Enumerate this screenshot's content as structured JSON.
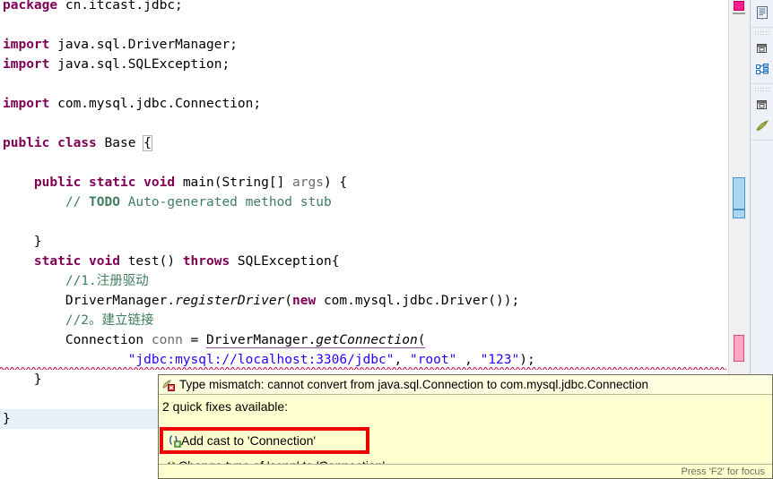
{
  "editor": {
    "language": "java",
    "lines": [
      {
        "id": 0,
        "indent": 0,
        "tokens": [
          {
            "t": "kw",
            "v": "package"
          },
          {
            "t": "p",
            "v": " cn.itcast.jdbc;"
          }
        ]
      },
      {
        "id": 1,
        "indent": 0,
        "tokens": []
      },
      {
        "id": 2,
        "indent": 0,
        "tokens": [
          {
            "t": "kw",
            "v": "import"
          },
          {
            "t": "p",
            "v": " java.sql.DriverManager;"
          }
        ]
      },
      {
        "id": 3,
        "indent": 0,
        "tokens": [
          {
            "t": "kw",
            "v": "import"
          },
          {
            "t": "p",
            "v": " java.sql.SQLException;"
          }
        ]
      },
      {
        "id": 4,
        "indent": 0,
        "tokens": []
      },
      {
        "id": 5,
        "indent": 0,
        "tokens": [
          {
            "t": "kw",
            "v": "import"
          },
          {
            "t": "p",
            "v": " com.mysql.jdbc.Connection;"
          }
        ]
      },
      {
        "id": 6,
        "indent": 0,
        "tokens": []
      },
      {
        "id": 7,
        "indent": 0,
        "tokens": [
          {
            "t": "kw",
            "v": "public"
          },
          {
            "t": "p",
            "v": " "
          },
          {
            "t": "kw",
            "v": "class"
          },
          {
            "t": "p",
            "v": " Base "
          },
          {
            "t": "cursor",
            "v": "{"
          }
        ]
      },
      {
        "id": 8,
        "indent": 0,
        "tokens": []
      },
      {
        "id": 9,
        "indent": 1,
        "tokens": [
          {
            "t": "kw",
            "v": "public"
          },
          {
            "t": "p",
            "v": " "
          },
          {
            "t": "kw",
            "v": "static"
          },
          {
            "t": "p",
            "v": " "
          },
          {
            "t": "kw",
            "v": "void"
          },
          {
            "t": "p",
            "v": " main(String[] "
          },
          {
            "t": "loc",
            "v": "args"
          },
          {
            "t": "p",
            "v": ") {"
          }
        ]
      },
      {
        "id": 10,
        "indent": 2,
        "tokens": [
          {
            "t": "cmt",
            "v": "// "
          },
          {
            "t": "todo",
            "v": "TODO"
          },
          {
            "t": "cmt",
            "v": " Auto-generated method stub"
          }
        ]
      },
      {
        "id": 11,
        "indent": 0,
        "tokens": []
      },
      {
        "id": 12,
        "indent": 1,
        "tokens": [
          {
            "t": "p",
            "v": "}"
          }
        ]
      },
      {
        "id": 13,
        "indent": 1,
        "tokens": [
          {
            "t": "kw",
            "v": "static"
          },
          {
            "t": "p",
            "v": " "
          },
          {
            "t": "kw",
            "v": "void"
          },
          {
            "t": "p",
            "v": " test() "
          },
          {
            "t": "kw",
            "v": "throws"
          },
          {
            "t": "p",
            "v": " SQLException{"
          }
        ]
      },
      {
        "id": 14,
        "indent": 2,
        "tokens": [
          {
            "t": "cmt",
            "v": "//1.注册驱动"
          }
        ]
      },
      {
        "id": 15,
        "indent": 2,
        "tokens": [
          {
            "t": "p",
            "v": "DriverManager."
          },
          {
            "t": "mth",
            "v": "registerDriver"
          },
          {
            "t": "p",
            "v": "("
          },
          {
            "t": "kw",
            "v": "new"
          },
          {
            "t": "p",
            "v": " com.mysql.jdbc.Driver());"
          }
        ]
      },
      {
        "id": 16,
        "indent": 2,
        "tokens": [
          {
            "t": "cmt",
            "v": "//2。建立链接"
          }
        ]
      },
      {
        "id": 17,
        "indent": 2,
        "tokens": [
          {
            "t": "p",
            "v": "Connection "
          },
          {
            "t": "loc",
            "v": "conn"
          },
          {
            "t": "p",
            "v": " = "
          },
          {
            "t": "ul",
            "v": "DriverManager."
          },
          {
            "t": "ulmth",
            "v": "getConnection"
          },
          {
            "t": "ul",
            "v": "("
          }
        ]
      },
      {
        "id": 18,
        "indent": 4,
        "tokens": [
          {
            "t": "str",
            "v": "\"jdbc:mysql://localhost:3306/jdbc\""
          },
          {
            "t": "p",
            "v": ", "
          },
          {
            "t": "str",
            "v": "\"root\""
          },
          {
            "t": "p",
            "v": " , "
          },
          {
            "t": "str",
            "v": "\"123\""
          },
          {
            "t": "p",
            "v": ");"
          }
        ]
      },
      {
        "id": 19,
        "indent": 1,
        "tokens": [
          {
            "t": "p",
            "v": "}"
          }
        ]
      },
      {
        "id": 20,
        "indent": 0,
        "tokens": [],
        "highlight": false
      },
      {
        "id": 21,
        "indent": 0,
        "tokens": [
          {
            "t": "p",
            "v": "}"
          }
        ],
        "highlight": true
      }
    ],
    "colors": {
      "keyword": "#7f0055",
      "comment": "#3f7f5f",
      "string": "#2a00ff",
      "local_variable": "#6a6a6a",
      "background": "#ffffff",
      "current_line_highlight": "#e8f0fa",
      "error_squiggle": "#c00040"
    }
  },
  "overview_ruler": {
    "top_arrow_icon": "chevron-up-icon",
    "markers": [
      {
        "name": "error-marker-top",
        "color": "#ff1f8f",
        "tooltip_kind": "error"
      },
      {
        "name": "visible-range-thumb",
        "color": "#a9d5f2",
        "tooltip_kind": "viewport"
      },
      {
        "name": "error-marker-current",
        "color": "#ffa8c8",
        "tooltip_kind": "error"
      }
    ]
  },
  "fast_view_bar": {
    "groups": [
      {
        "buttons": [
          {
            "name": "outline-view-icon"
          }
        ]
      },
      {
        "buttons": [
          {
            "name": "restore-view-icon"
          },
          {
            "name": "package-explorer-icon"
          }
        ]
      },
      {
        "buttons": [
          {
            "name": "restore-view-icon"
          },
          {
            "name": "javadoc-view-icon"
          }
        ]
      }
    ]
  },
  "popup": {
    "icon": "error-marker-icon",
    "message": "Type mismatch: cannot convert from java.sql.Connection to com.mysql.jdbc.Connection",
    "header": "2 quick fixes available:",
    "quick_fixes": [
      {
        "icon": "add-cast-icon",
        "label": "Add cast to 'Connection'",
        "selected": true
      },
      {
        "icon": "change-type-icon",
        "label": "Change type of 'conn' to 'Connection'",
        "selected": false
      }
    ],
    "footer": "Press 'F2' for focus",
    "selection_outline_color": "#ee0000",
    "background": "#ffffd0",
    "link_color": "#1a4f9c"
  }
}
